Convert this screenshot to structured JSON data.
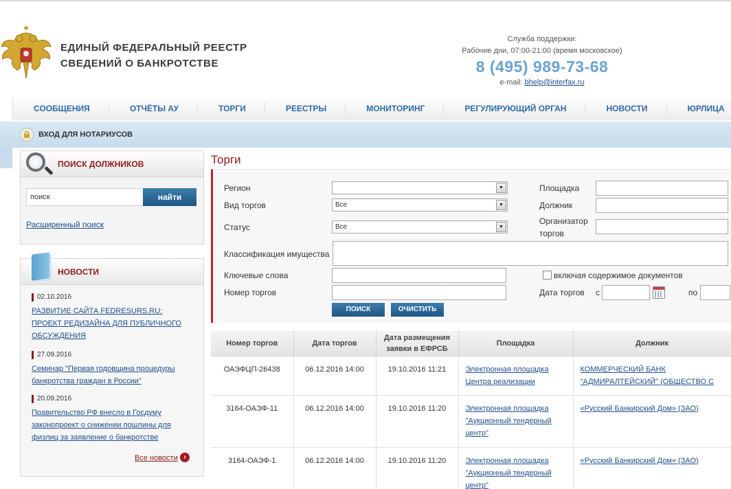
{
  "header": {
    "title_line1": "ЕДИНЫЙ  ФЕДЕРАЛЬНЫЙ  РЕЕСТР",
    "title_line2": "СВЕДЕНИЙ О БАНКРОТСТВЕ",
    "support_label": "Служба поддержки:",
    "support_hours": "Рабочие дни, 07:00-21:00 (время московское)",
    "support_phone": "8 (495) 989-73-68",
    "support_email_label": "e-mail:",
    "support_email": "bhelp@interfax.ru"
  },
  "nav": {
    "items": [
      {
        "label": "СООБЩЕНИЯ"
      },
      {
        "label": "ОТЧЁТЫ АУ"
      },
      {
        "label": "ТОРГИ"
      },
      {
        "label": "РЕЕСТРЫ"
      },
      {
        "label": "МОНИТОРИНГ"
      },
      {
        "label": "РЕГУЛИРУЮЩИЙ ОРГАН"
      },
      {
        "label": "НОВОСТИ"
      },
      {
        "label": "ЮРЛИЦА"
      }
    ]
  },
  "notary": {
    "label": "ВХОД ДЛЯ НОТАРИУСОВ"
  },
  "debtor_search": {
    "title": "ПОИСК ДОЛЖНИКОВ",
    "input_value": "поиск",
    "button_label": "найти",
    "advanced_link": "Расширенный поиск"
  },
  "news": {
    "title": "НОВОСТИ",
    "items": [
      {
        "date": "02.10.2016",
        "text": "РАЗВИТИЕ САЙТА FEDRESURS.RU: ПРОЕКТ РЕДИЗАЙНА ДЛЯ ПУБЛИЧНОГО ОБСУЖДЕНИЯ"
      },
      {
        "date": "27.09.2016",
        "text": "Семинар \"Первая годовщина процедуры банкротства граждан в России\""
      },
      {
        "date": "20.09.2016",
        "text": "Правительство РФ внесло в Госдуму законопроект о снижении пошлины для физлиц за заявление о банкротстве"
      }
    ],
    "all_news_link": "Все новости"
  },
  "page_title": "Торги",
  "filters": {
    "region_label": "Регион",
    "region_value": "",
    "trade_type_label": "Вид торгов",
    "trade_type_value": "Все",
    "status_label": "Статус",
    "status_value": "Все",
    "property_class_label": "Классификация имущества",
    "keywords_label": "Ключевые слова",
    "trade_number_label": "Номер торгов",
    "platform_label": "Площадка",
    "debtor_label": "Должник",
    "organizer_label": "Организатор торгов",
    "include_docs_label": "включая содержимое документов",
    "trade_date_label": "Дата торгов",
    "date_from_label": "с",
    "date_to_label": "по",
    "search_button": "ПОИСК",
    "clear_button": "ОЧИСТИТЬ",
    "dropdown_arrow": "▼"
  },
  "table": {
    "headers": [
      "Номер торгов",
      "Дата торгов",
      "Дата размещения заявки в ЕФРСБ",
      "Площадка",
      "Должник"
    ],
    "rows": [
      {
        "number": "ОАЭФЦП-26438",
        "trade_date": "06.12.2016 14:00",
        "posted_date": "19.10.2016 11:21",
        "platform": "Электронная площадка Центра реализации",
        "debtor": "КОММЕРЧЕСКИЙ БАНК \"АДМИРАЛТЕЙСКИЙ\" (ОБЩЕСТВО С ОГРАНИЧЕННОЙ ОТВЕТСТВЕННОСТЬЮ)"
      },
      {
        "number": "3164-ОАЭФ-11",
        "trade_date": "06.12.2016 14:00",
        "posted_date": "19.10.2016 11:20",
        "platform": "Электронная площадка \"Аукционный тендерный центр\"",
        "debtor": "«Русский Банкирский Дом» (ЗАО)"
      },
      {
        "number": "3164-ОАЭФ-1",
        "trade_date": "06.12.2016 14:00",
        "posted_date": "19.10.2016 11:20",
        "platform": "Электронная площадка \"Аукционный тендерный центр\"",
        "debtor": "«Русский Банкирский Дом» (ЗАО)"
      }
    ]
  },
  "colors": {
    "brand_blue": "#2f6aa6",
    "accent_red": "#8b1a1a",
    "phone_blue": "#6aa2cf",
    "button_blue": "#1d5685"
  }
}
